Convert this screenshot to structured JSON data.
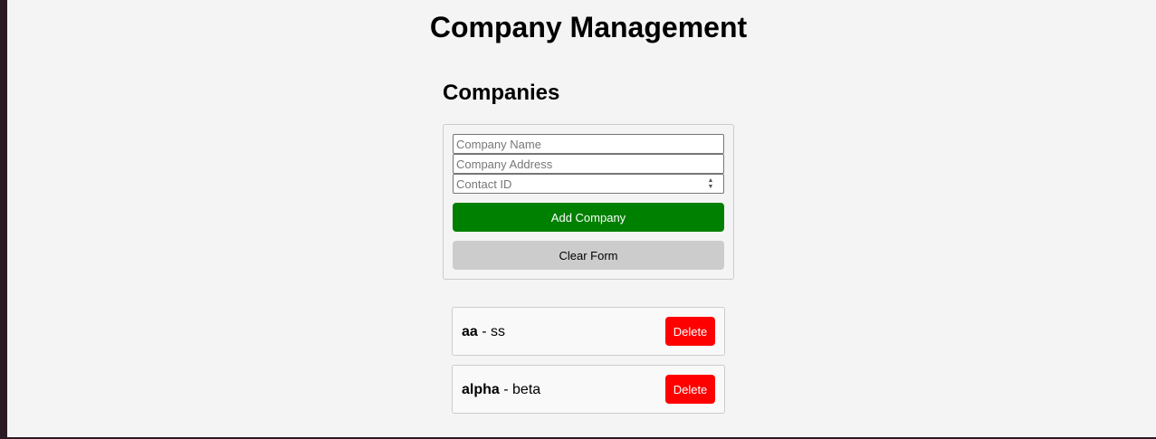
{
  "header": {
    "title": "Company Management"
  },
  "section": {
    "title": "Companies"
  },
  "form": {
    "name_placeholder": "Company Name",
    "address_placeholder": "Company Address",
    "contact_placeholder": "Contact ID",
    "add_label": "Add Company",
    "clear_label": "Clear Form"
  },
  "companies": [
    {
      "name": "aa",
      "separator": " - ",
      "address": "ss",
      "delete_label": "Delete"
    },
    {
      "name": "alpha",
      "separator": " - ",
      "address": "beta",
      "delete_label": "Delete"
    }
  ],
  "colors": {
    "add_button": "#008000",
    "clear_button": "#cccccc",
    "delete_button": "#ff0000",
    "background": "#f4f4f4"
  }
}
